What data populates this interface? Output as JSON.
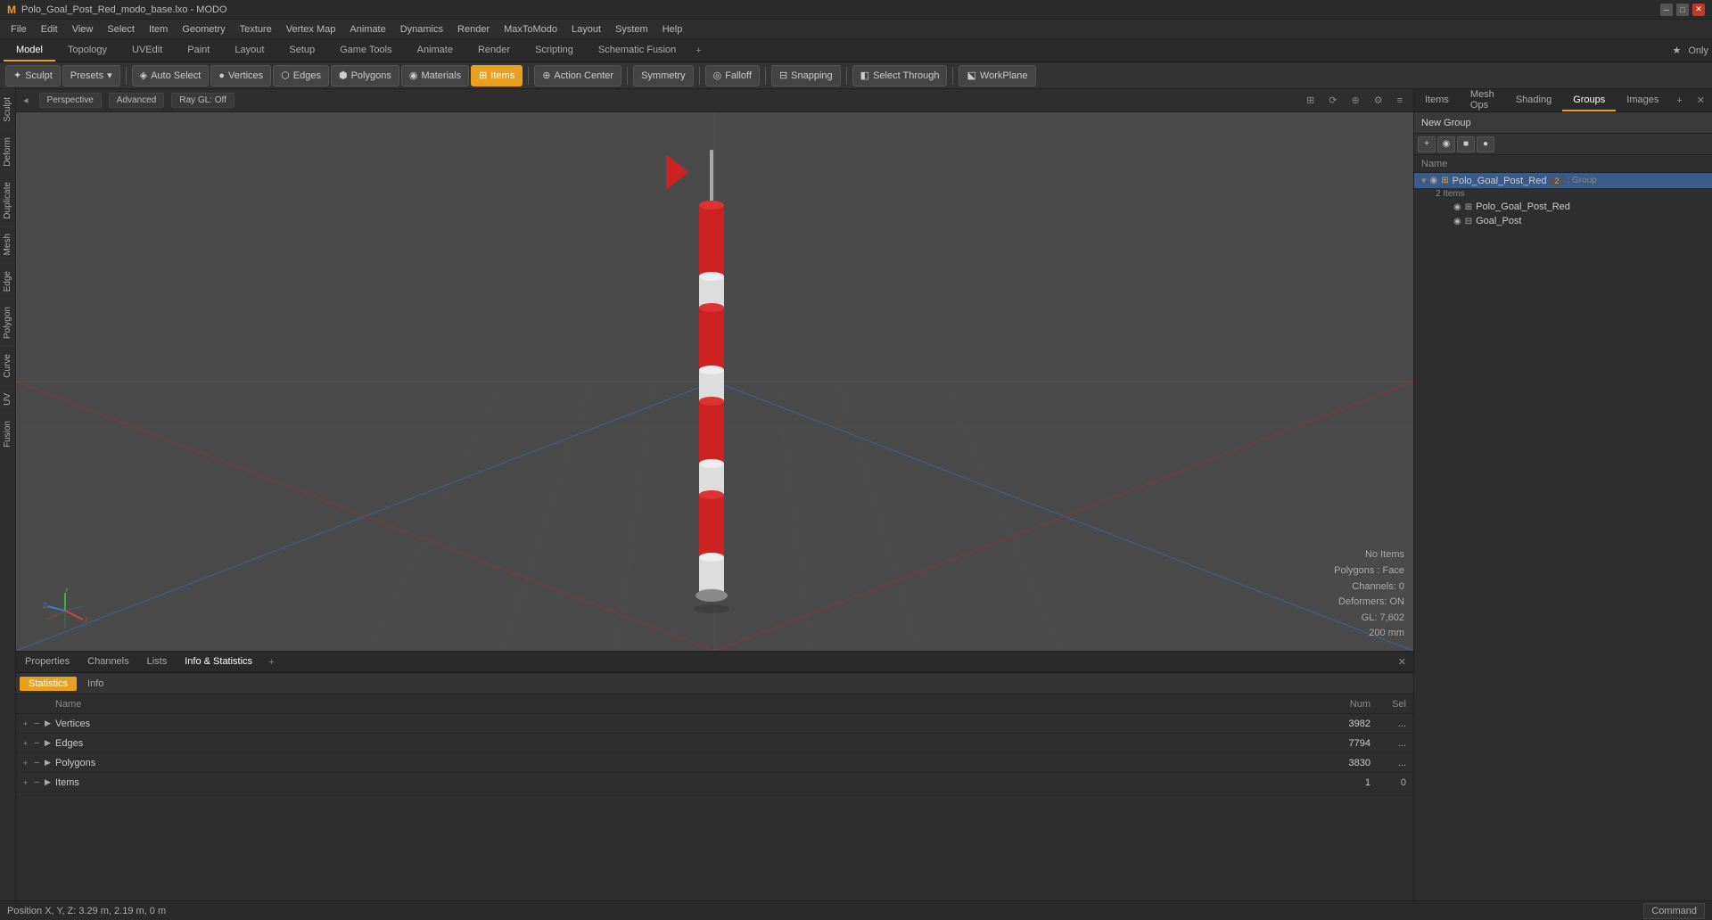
{
  "titlebar": {
    "title": "Polo_Goal_Post_Red_modo_base.lxo - MODO",
    "controls": [
      "minimize",
      "maximize",
      "close"
    ]
  },
  "menubar": {
    "items": [
      "File",
      "Edit",
      "View",
      "Select",
      "Item",
      "Geometry",
      "Texture",
      "Vertex Map",
      "Animate",
      "Dynamics",
      "Render",
      "MaxToModo",
      "Layout",
      "System",
      "Help"
    ]
  },
  "modetabs": {
    "items": [
      "Model",
      "Topology",
      "UVEdit",
      "Paint",
      "Layout",
      "Setup",
      "Game Tools",
      "Animate",
      "Render",
      "Scripting",
      "Schematic Fusion"
    ],
    "active": "Model",
    "right": {
      "only_label": "Only"
    }
  },
  "toolbar": {
    "sculpt_label": "Sculpt",
    "presets_label": "Presets",
    "auto_select_label": "Auto Select",
    "vertices_label": "Vertices",
    "edges_label": "Edges",
    "polygons_label": "Polygons",
    "materials_label": "Materials",
    "items_label": "Items",
    "action_center_label": "Action Center",
    "symmetry_label": "Symmetry",
    "falloff_label": "Falloff",
    "snapping_label": "Snapping",
    "select_through_label": "Select Through",
    "workplane_label": "WorkPlane"
  },
  "viewport": {
    "mode": "Perspective",
    "shading": "Advanced",
    "raygl": "Ray GL: Off"
  },
  "right_panel": {
    "tabs": [
      "Items",
      "Mesh Ops",
      "Shading",
      "Groups",
      "Images"
    ],
    "active": "Groups",
    "new_group_label": "New Group",
    "name_header": "Name",
    "tree": {
      "root": {
        "label": "Polo_Goal_Post_Red",
        "badge": "2",
        "type": "Group",
        "expanded": true,
        "sub_label": "2 Items",
        "children": [
          {
            "label": "Polo_Goal_Post_Red",
            "type": "mesh"
          },
          {
            "label": "Goal_Post",
            "type": "mesh"
          }
        ]
      }
    }
  },
  "bottom_panel": {
    "tabs": [
      "Properties",
      "Channels",
      "Lists",
      "Info & Statistics"
    ],
    "active": "Info & Statistics",
    "stats_tabs": [
      "Statistics",
      "Info"
    ],
    "active_stats_tab": "Statistics",
    "header": {
      "name": "Name",
      "num": "Num",
      "sel": "Sel"
    },
    "rows": [
      {
        "label": "Vertices",
        "num": "3982",
        "sel": "..."
      },
      {
        "label": "Edges",
        "num": "7794",
        "sel": "..."
      },
      {
        "label": "Polygons",
        "num": "3830",
        "sel": "..."
      },
      {
        "label": "Items",
        "num": "1",
        "sel": "0"
      }
    ]
  },
  "statusbar": {
    "position_label": "Position X, Y, Z:",
    "position_value": "3.29 m, 2.19 m, 0 m",
    "command_label": "Command"
  },
  "viewport_info": {
    "no_items": "No Items",
    "polygons": "Polygons : Face",
    "channels": "Channels: 0",
    "deformers": "Deformers: ON",
    "gl": "GL: 7,602",
    "zoom": "200 mm"
  }
}
